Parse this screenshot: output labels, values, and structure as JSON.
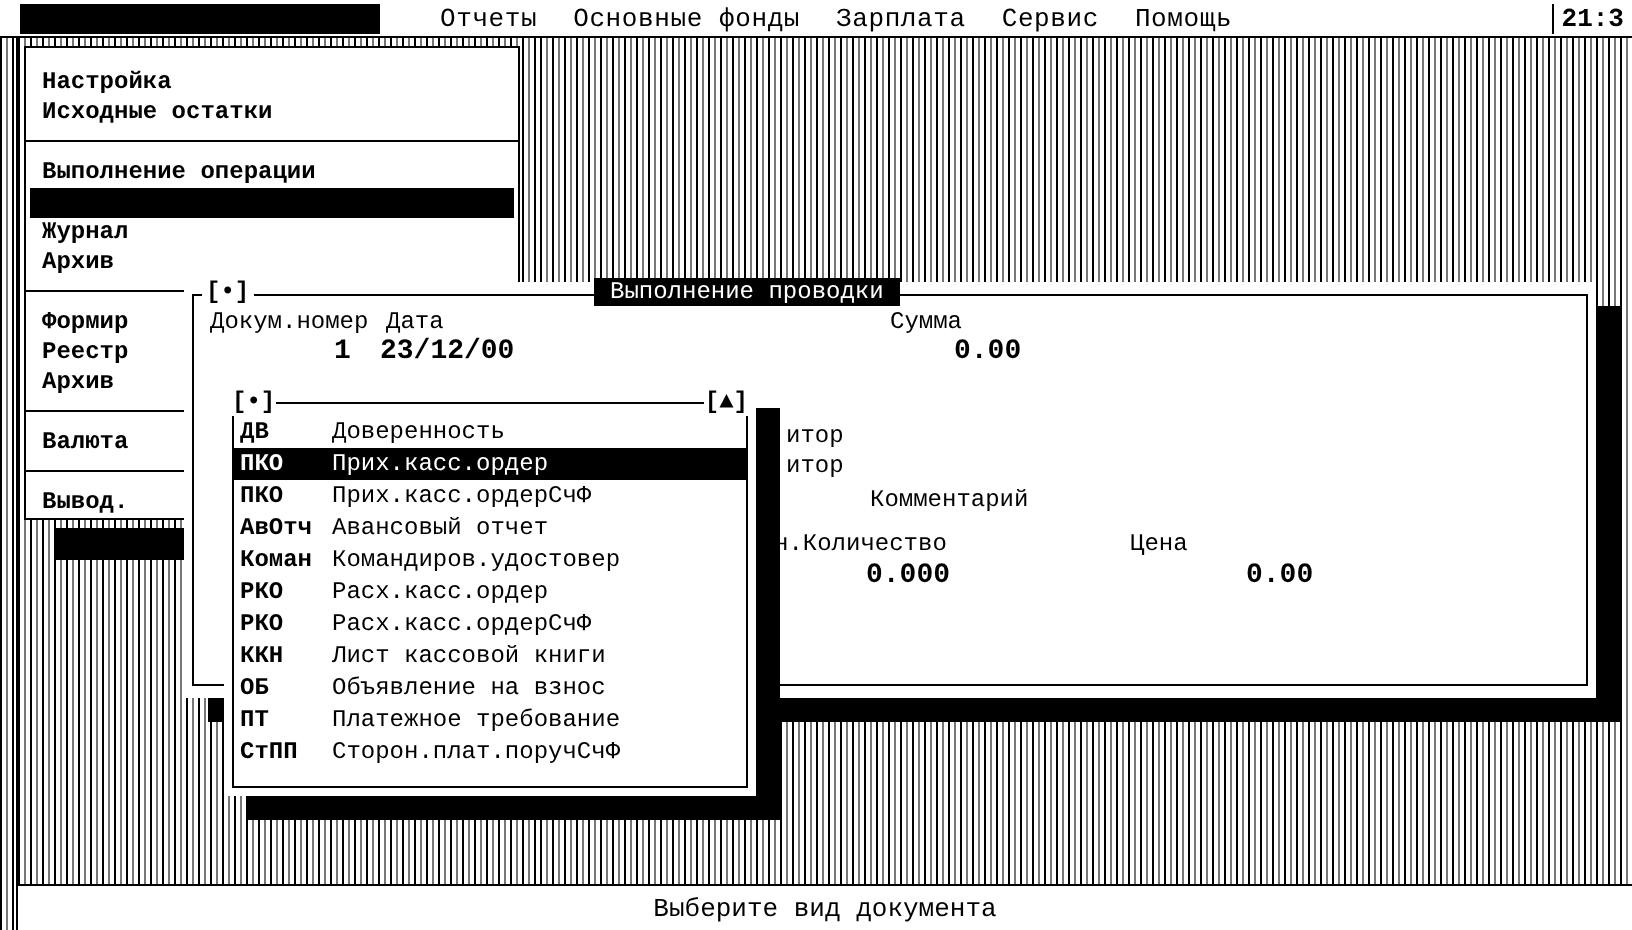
{
  "menu_bar": {
    "items": [
      {
        "label": "Отчеты"
      },
      {
        "label": "Основные фонды"
      },
      {
        "label": "Зарплата"
      },
      {
        "label": "Сервис"
      },
      {
        "label": "Помощь"
      }
    ],
    "clock": "21:3"
  },
  "side_menu": {
    "groups": [
      [
        {
          "label": "Настройка",
          "selected": false
        },
        {
          "label": "Исходные остатки",
          "selected": false
        }
      ],
      [
        {
          "label": "Выполнение операции",
          "selected": false
        },
        {
          "selected": true
        },
        {
          "label": "Журнал",
          "selected": false
        },
        {
          "label": "Архив",
          "selected": false
        }
      ],
      [
        {
          "label": "Формир",
          "selected": false
        },
        {
          "label": "Реестр",
          "selected": false
        },
        {
          "label": "Архив",
          "selected": false
        }
      ],
      [
        {
          "label": "Валюта",
          "selected": false
        }
      ],
      [
        {
          "label": "Вывод.",
          "selected": false
        }
      ]
    ]
  },
  "dialog": {
    "title": "Выполнение проводки",
    "close_box": "[•]",
    "fields": [
      {
        "kind": "label",
        "text": "Докум.номер"
      },
      {
        "kind": "label",
        "text": "Дата"
      },
      {
        "kind": "label",
        "text": "Сумма"
      },
      {
        "kind": "value",
        "text": "1"
      },
      {
        "kind": "value",
        "text": "23/12/00"
      },
      {
        "kind": "value",
        "text": "0.00"
      },
      {
        "kind": "label",
        "text": "итор"
      },
      {
        "kind": "label",
        "text": "итор"
      },
      {
        "kind": "label",
        "text": "Комментарий"
      },
      {
        "kind": "label",
        "text": "н.Количество"
      },
      {
        "kind": "label",
        "text": "Цена"
      },
      {
        "kind": "value",
        "text": "0.000"
      },
      {
        "kind": "value",
        "text": "0.00"
      }
    ]
  },
  "document_list": {
    "close_box": "[•]",
    "zoom_box": "[▲]",
    "items": [
      {
        "code": "ДВ",
        "name": "Доверенность",
        "selected": false
      },
      {
        "code": "ПКО",
        "name": "Прих.касс.ордер",
        "selected": true
      },
      {
        "code": "ПКО",
        "name": "Прих.касс.ордерСчФ",
        "selected": false
      },
      {
        "code": "АвОтч",
        "name": "Авансовый отчет",
        "selected": false
      },
      {
        "code": "Коман",
        "name": "Командиров.удостовер",
        "selected": false
      },
      {
        "code": "РКО",
        "name": "Расх.касс.ордер",
        "selected": false
      },
      {
        "code": "РКО",
        "name": "Расх.касс.ордерСчФ",
        "selected": false
      },
      {
        "code": "ККН",
        "name": "Лист кассовой книги",
        "selected": false
      },
      {
        "code": "ОБ",
        "name": "Объявление на взнос",
        "selected": false
      },
      {
        "code": "ПТ",
        "name": "Платежное требование",
        "selected": false
      },
      {
        "code": "СтПП",
        "name": "Сторон.плат.поручСчФ",
        "selected": false
      }
    ]
  },
  "status_bar": "Выберите вид документа"
}
